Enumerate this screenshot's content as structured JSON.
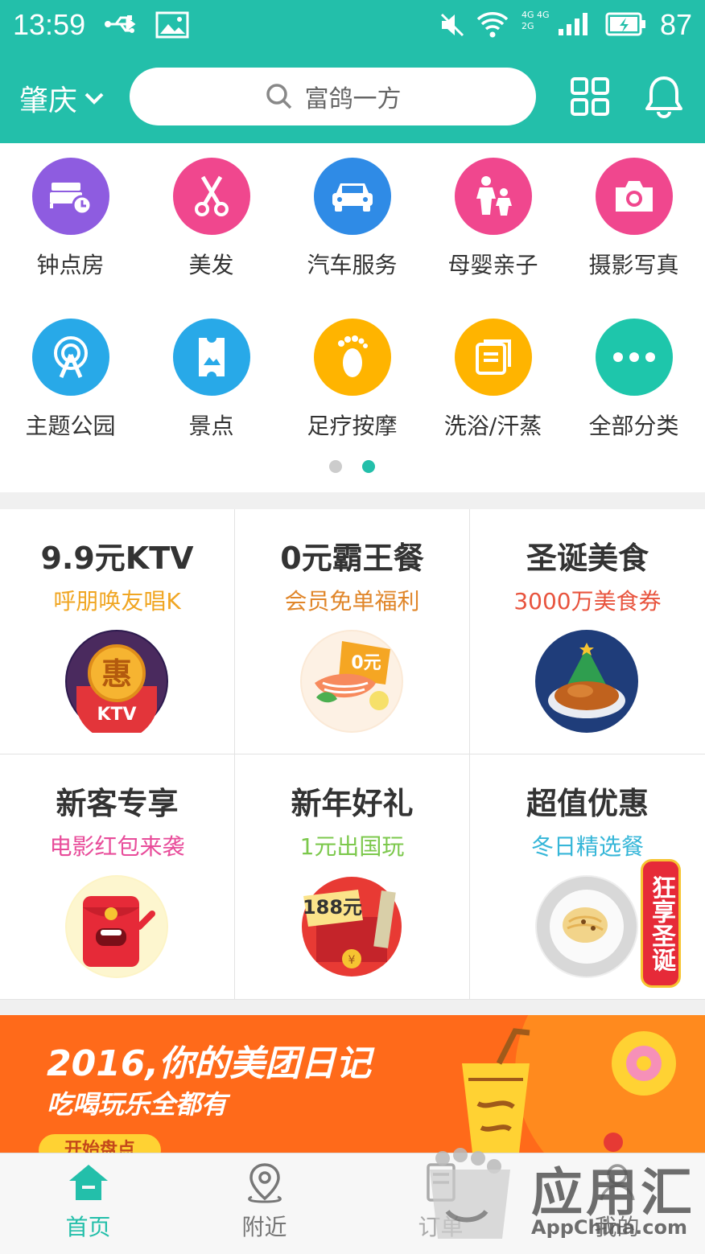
{
  "status_bar": {
    "time": "13:59",
    "net_top": "4G 4G",
    "net_bottom": "2G",
    "battery": "87"
  },
  "header": {
    "city": "肇庆",
    "search_placeholder": "富鸽一方"
  },
  "categories": [
    {
      "label": "钟点房",
      "icon": "hourly-room-icon",
      "color": "#8e5ce0"
    },
    {
      "label": "美发",
      "icon": "scissors-icon",
      "color": "#f0478e"
    },
    {
      "label": "汽车服务",
      "icon": "car-icon",
      "color": "#2f8be6"
    },
    {
      "label": "母婴亲子",
      "icon": "parent-child-icon",
      "color": "#f0478e"
    },
    {
      "label": "摄影写真",
      "icon": "camera-icon",
      "color": "#f0478e"
    },
    {
      "label": "主题公园",
      "icon": "ferris-wheel-icon",
      "color": "#28a9e8"
    },
    {
      "label": "景点",
      "icon": "ticket-icon",
      "color": "#28a9e8"
    },
    {
      "label": "足疗按摩",
      "icon": "foot-icon",
      "color": "#ffb400"
    },
    {
      "label": "洗浴/汗蒸",
      "icon": "bath-icon",
      "color": "#ffb400"
    },
    {
      "label": "全部分类",
      "icon": "more-icon",
      "color": "#1ec6ab"
    }
  ],
  "pager": {
    "inactive_color": "#cccccc",
    "active_color": "#23bfaa"
  },
  "promos": [
    {
      "title": "9.9元KTV",
      "subtitle": "呼朋唤友唱K",
      "sub_color": "#f0a623",
      "image": "ktv-coupon-image",
      "badge": "惠",
      "tag": "KTV"
    },
    {
      "title": "0元霸王餐",
      "subtitle": "会员免单福利",
      "sub_color": "#e0862a",
      "image": "salmon-dish-image",
      "badge": "0元"
    },
    {
      "title": "圣诞美食",
      "subtitle": "3000万美食券",
      "sub_color": "#e8543e",
      "image": "roast-turkey-image"
    },
    {
      "title": "新客专享",
      "subtitle": "电影红包来袭",
      "sub_color": "#e84c9a",
      "image": "red-envelope-image"
    },
    {
      "title": "新年好礼",
      "subtitle": "1元出国玩",
      "sub_color": "#7cc84c",
      "image": "travel-ticket-image",
      "badge": "188元"
    },
    {
      "title": "超值优惠",
      "subtitle": "冬日精选餐",
      "sub_color": "#35b6d8",
      "image": "pasta-plate-image",
      "ribbon": "狂享圣诞"
    }
  ],
  "banner": {
    "line1": "2016,你的美团日记",
    "line2": "吃喝玩乐全都有",
    "button": "开始盘点"
  },
  "tabs": [
    {
      "label": "首页",
      "icon": "home-icon"
    },
    {
      "label": "附近",
      "icon": "location-pin-icon"
    },
    {
      "label": "订单",
      "icon": "order-icon"
    },
    {
      "label": "我的",
      "icon": "profile-icon"
    }
  ],
  "watermark": {
    "big": "应用汇",
    "small": "AppChina.com"
  }
}
